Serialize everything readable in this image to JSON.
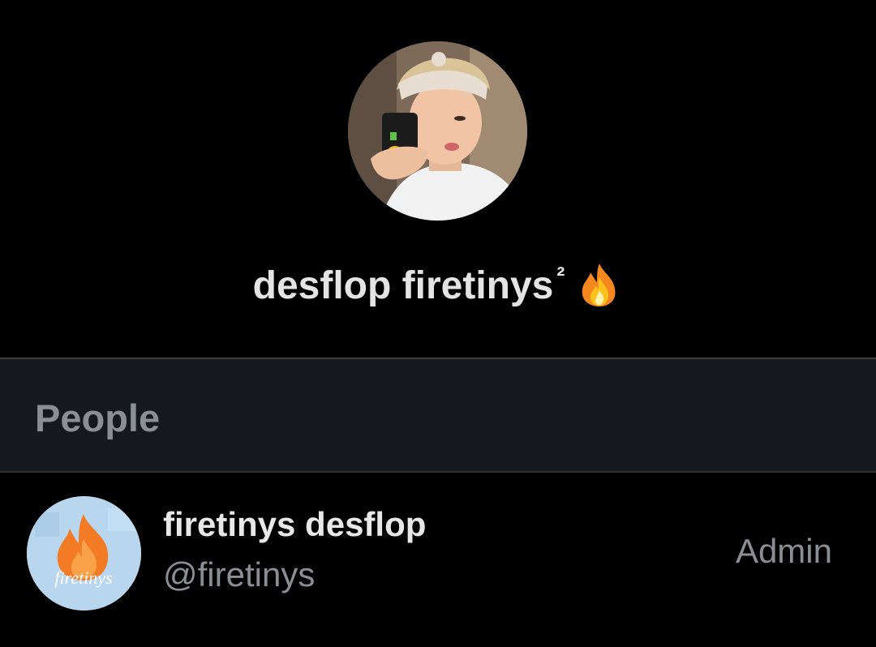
{
  "group": {
    "title": "desflop firetinys",
    "title_suffix": "²",
    "title_emoji_icon": "fire-icon",
    "avatar": "profile-photo-icon"
  },
  "sections": {
    "people_label": "People"
  },
  "members": [
    {
      "display_name": "firetinys desflop",
      "handle": "@firetinys",
      "role": "Admin",
      "avatar": "firetinys-logo-icon",
      "avatar_text": "firetinys"
    }
  ],
  "colors": {
    "background": "#000000",
    "section_background": "#15181c",
    "primary_text": "#e4e4e4",
    "secondary_text": "#8a8f96",
    "divider": "#3a3d42"
  }
}
